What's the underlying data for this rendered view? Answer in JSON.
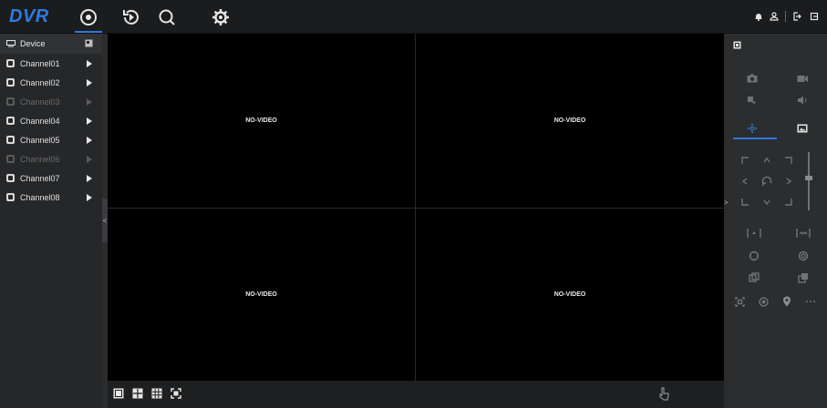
{
  "app": {
    "logo": "DVR"
  },
  "nav": {
    "items": [
      {
        "name": "live-view",
        "icon": "live-view-icon",
        "active": true
      },
      {
        "name": "playback",
        "icon": "playback-icon",
        "active": false
      },
      {
        "name": "search",
        "icon": "search-icon",
        "active": false
      },
      {
        "name": "settings",
        "icon": "gear-icon",
        "active": false
      }
    ]
  },
  "sidebar": {
    "device_label": "Device",
    "channels": [
      {
        "label": "Channel01",
        "enabled": true
      },
      {
        "label": "Channel02",
        "enabled": true
      },
      {
        "label": "Channel03",
        "enabled": false
      },
      {
        "label": "Channel04",
        "enabled": true
      },
      {
        "label": "Channel05",
        "enabled": true
      },
      {
        "label": "Channel06",
        "enabled": false
      },
      {
        "label": "Channel07",
        "enabled": true
      },
      {
        "label": "Channel08",
        "enabled": true
      }
    ],
    "collapse_glyph": "<"
  },
  "video": {
    "cells": [
      {
        "text": "NO-VIDEO"
      },
      {
        "text": "NO-VIDEO"
      },
      {
        "text": "NO-VIDEO"
      },
      {
        "text": "NO-VIDEO"
      }
    ]
  },
  "right_panel": {
    "collapse_glyph": ">"
  },
  "colors": {
    "accent": "#2d7be2",
    "background": "#2a2c2e",
    "video_bg": "#000000"
  }
}
